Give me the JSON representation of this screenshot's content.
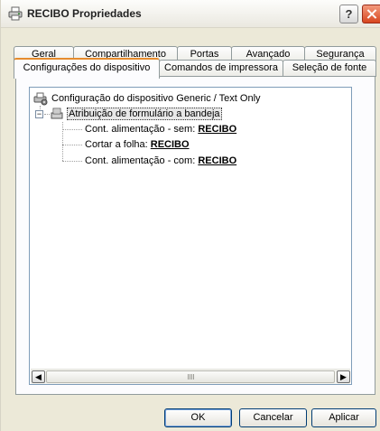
{
  "window": {
    "title": "RECIBO Propriedades",
    "help_label": "?"
  },
  "tabs_row1": [
    {
      "label": "Geral"
    },
    {
      "label": "Compartilhamento"
    },
    {
      "label": "Portas"
    },
    {
      "label": "Avançado"
    },
    {
      "label": "Segurança"
    }
  ],
  "tabs_row2": [
    {
      "label": "Configurações do dispositivo",
      "active": true
    },
    {
      "label": "Comandos de impressora"
    },
    {
      "label": "Seleção de fonte"
    }
  ],
  "tree": {
    "root": "Configuração do dispositivo Generic / Text Only",
    "node": "Atribuição de formulário a bandeja",
    "expander": "−",
    "children": [
      {
        "label": "Cont. alimentação - sem:",
        "value": "RECIBO"
      },
      {
        "label": "Cortar a folha:",
        "value": "RECIBO"
      },
      {
        "label": "Cont. alimentação - com:",
        "value": "RECIBO"
      }
    ]
  },
  "scrollbar": {
    "left_arrow": "◀",
    "right_arrow": "▶"
  },
  "buttons": {
    "ok": "OK",
    "cancel": "Cancelar",
    "apply": "Aplicar"
  }
}
